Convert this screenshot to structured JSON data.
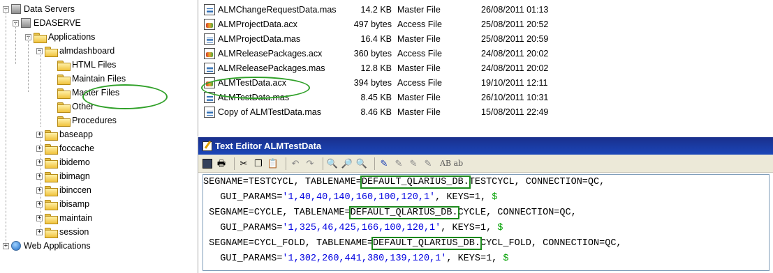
{
  "tree": {
    "items": [
      {
        "label": "Data Servers",
        "level": 0,
        "expander": "−",
        "icon": "server-icon"
      },
      {
        "label": "EDASERVE",
        "level": 1,
        "expander": "−",
        "icon": "server-icon"
      },
      {
        "label": "Applications",
        "level": 2,
        "expander": "−",
        "icon": "folder-icon"
      },
      {
        "label": "almdashboard",
        "level": 3,
        "expander": "−",
        "icon": "folder-icon"
      },
      {
        "label": "HTML Files",
        "level": 4,
        "expander": "",
        "icon": "folder-icon"
      },
      {
        "label": "Maintain Files",
        "level": 4,
        "expander": "",
        "icon": "folder-icon"
      },
      {
        "label": "Master Files",
        "level": 4,
        "expander": "",
        "icon": "folder-icon",
        "selected": true
      },
      {
        "label": "Other",
        "level": 4,
        "expander": "",
        "icon": "folder-icon"
      },
      {
        "label": "Procedures",
        "level": 4,
        "expander": "",
        "icon": "folder-icon"
      },
      {
        "label": "baseapp",
        "level": 3,
        "expander": "+",
        "icon": "folder-icon"
      },
      {
        "label": "foccache",
        "level": 3,
        "expander": "+",
        "icon": "folder-icon"
      },
      {
        "label": "ibidemo",
        "level": 3,
        "expander": "+",
        "icon": "folder-icon"
      },
      {
        "label": "ibimagn",
        "level": 3,
        "expander": "+",
        "icon": "folder-icon"
      },
      {
        "label": "ibinccen",
        "level": 3,
        "expander": "+",
        "icon": "folder-icon"
      },
      {
        "label": "ibisamp",
        "level": 3,
        "expander": "+",
        "icon": "folder-icon"
      },
      {
        "label": "maintain",
        "level": 3,
        "expander": "+",
        "icon": "folder-icon"
      },
      {
        "label": "session",
        "level": 3,
        "expander": "+",
        "icon": "folder-icon"
      },
      {
        "label": "Web Applications",
        "level": 0,
        "expander": "+",
        "icon": "globe-icon"
      }
    ]
  },
  "files": [
    {
      "name": "ALMChangeRequestData.mas",
      "size": "14.2 KB",
      "type": "Master File",
      "date": "26/08/2011 01:13",
      "kind": "mas"
    },
    {
      "name": "ALMProjectData.acx",
      "size": "497 bytes",
      "type": "Access File",
      "date": "25/08/2011 20:52",
      "kind": "acx"
    },
    {
      "name": "ALMProjectData.mas",
      "size": "16.4 KB",
      "type": "Master File",
      "date": "25/08/2011 20:59",
      "kind": "mas"
    },
    {
      "name": "ALMReleasePackages.acx",
      "size": "360 bytes",
      "type": "Access File",
      "date": "24/08/2011 20:02",
      "kind": "acx"
    },
    {
      "name": "ALMReleasePackages.mas",
      "size": "12.8 KB",
      "type": "Master File",
      "date": "24/08/2011 20:02",
      "kind": "mas"
    },
    {
      "name": "ALMTestData.acx",
      "size": "394 bytes",
      "type": "Access File",
      "date": "19/10/2011 12:11",
      "kind": "acx"
    },
    {
      "name": "ALMTestData.mas",
      "size": "8.45 KB",
      "type": "Master File",
      "date": "26/10/2011 10:31",
      "kind": "mas"
    },
    {
      "name": "Copy of ALMTestData.mas",
      "size": "8.46 KB",
      "type": "Master File",
      "date": "15/08/2011 22:49",
      "kind": "mas"
    }
  ],
  "editor": {
    "title": "Text Editor ALMTestData",
    "toolbar_text": "AB ab",
    "lines": [
      {
        "pre": "SEGNAME=TESTCYCL, TABLENAME=",
        "hl": "DEFAULT_QLARIUS_DB.",
        "post": "TESTCYCL, CONNECTION=QC,"
      },
      {
        "pre": "   GUI_PARAMS=",
        "str": "'1,40,40,140,160,100,120,1'",
        "post": ", KEYS=1, ",
        "dollar": "$"
      },
      {
        "pre": " SEGNAME=CYCLE, TABLENAME=",
        "hl": "DEFAULT_QLARIUS_DB.",
        "post": "CYCLE, CONNECTION=QC,"
      },
      {
        "pre": "   GUI_PARAMS=",
        "str": "'1,325,46,425,166,100,120,1'",
        "post": ", KEYS=1, ",
        "dollar": "$"
      },
      {
        "pre": " SEGNAME=CYCL_FOLD, TABLENAME=",
        "hl": "DEFAULT_QLARIUS_DB.",
        "post": "CYCL_FOLD, CONNECTION=QC,"
      },
      {
        "pre": "   GUI_PARAMS=",
        "str": "'1,302,260,441,380,139,120,1'",
        "post": ", KEYS=1, ",
        "dollar": "$"
      }
    ]
  }
}
